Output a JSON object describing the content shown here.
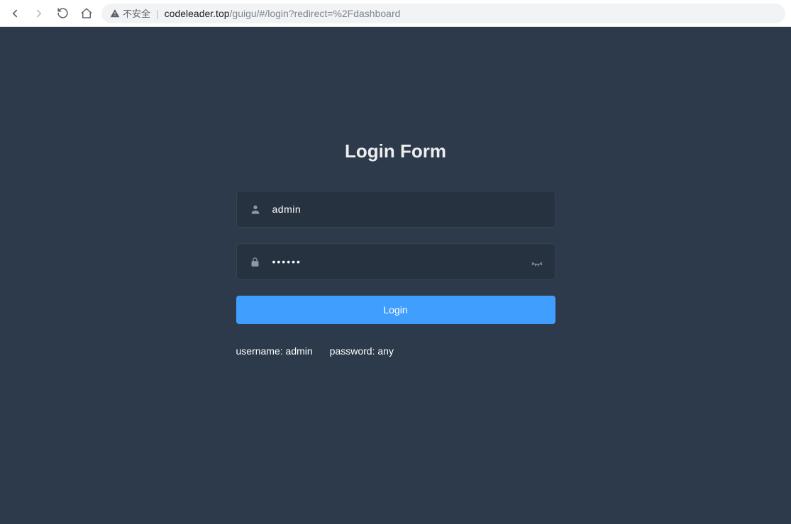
{
  "browser": {
    "security_label": "不安全",
    "url_host": "codeleader.top",
    "url_path": "/guigu/#/login?redirect=%2Fdashboard"
  },
  "login": {
    "title": "Login Form",
    "username_value": "admin",
    "password_value": "••••••",
    "button_label": "Login",
    "tip_username": "username: admin",
    "tip_password": "password: any"
  }
}
